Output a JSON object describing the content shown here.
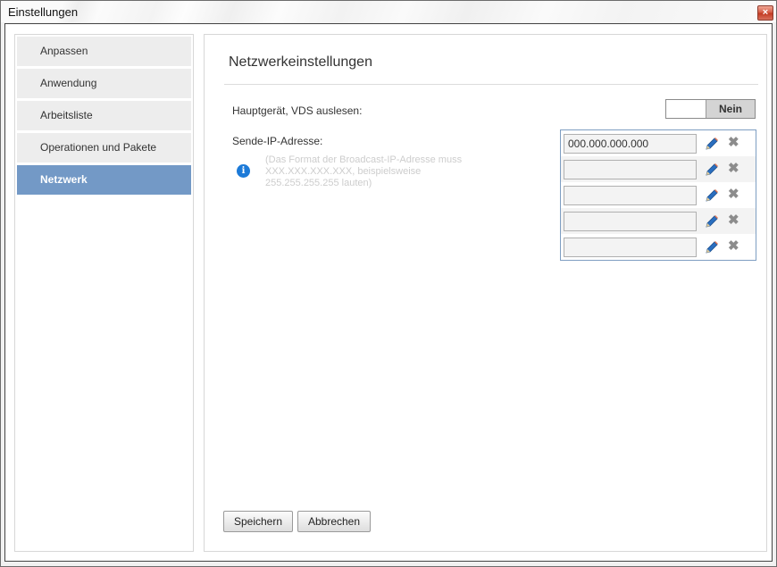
{
  "window": {
    "title": "Einstellungen",
    "close_glyph": "×"
  },
  "sidebar": {
    "items": [
      {
        "label": "Anpassen",
        "active": false
      },
      {
        "label": "Anwendung",
        "active": false
      },
      {
        "label": "Arbeitsliste",
        "active": false
      },
      {
        "label": "Operationen und Pakete",
        "active": false
      },
      {
        "label": "Netzwerk",
        "active": true
      }
    ]
  },
  "main": {
    "heading": "Netzwerkeinstellungen",
    "vds_label": "Hauptgerät, VDS auslesen:",
    "vds_toggle": {
      "value": "Nein"
    },
    "ip_label": "Sende-IP-Adresse:",
    "info_glyph": "i",
    "hint_text": "(Das Format der Broadcast-IP-Adresse muss   XXX.XXX.XXX.XXX, beispielsweise 255.255.255.255 lauten)",
    "ip_entries": [
      {
        "value": "000.000.000.000"
      },
      {
        "value": ""
      },
      {
        "value": ""
      },
      {
        "value": ""
      },
      {
        "value": ""
      }
    ],
    "delete_glyph": "✖",
    "save_label": "Speichern",
    "cancel_label": "Abbrechen"
  },
  "colors": {
    "active_nav": "#7399c6",
    "nav_bg": "#ededed",
    "panel_border": "#7e9ec2",
    "info_icon": "#1c7ad8",
    "pencil_blue": "#2a6fc0"
  }
}
